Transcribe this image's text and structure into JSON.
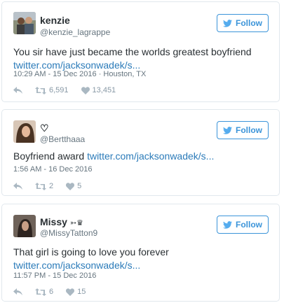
{
  "colors": {
    "accent": "#3b94d9",
    "link": "#2b7bb9",
    "muted": "#66757f",
    "icon": "#aab8c2"
  },
  "tweets": [
    {
      "name": "kenzie",
      "handle": "@kenzie_lagrappe",
      "follow_label": "Follow",
      "text": "You sir have just became the worlds greatest boyfriend",
      "link": "twitter.com/jacksonwadek/s...",
      "meta": "10:29 AM - 15 Dec 2016 · Houston, TX",
      "retweets": "6,591",
      "likes": "13,451"
    },
    {
      "name": "♡",
      "handle": "@Bertthaaa",
      "follow_label": "Follow",
      "text": "Boyfriend award",
      "link": "twitter.com/jacksonwadek/s...",
      "meta": "1:56 AM - 16 Dec 2016",
      "retweets": "2",
      "likes": "5"
    },
    {
      "name": "Missy",
      "name_emoji": "➳♛",
      "handle": "@MissyTatton9",
      "follow_label": "Follow",
      "text": "That girl is going to love you forever",
      "link": "twitter.com/jacksonwadek/s...",
      "meta": "11:57 PM - 15 Dec 2016",
      "retweets": "6",
      "likes": "15"
    }
  ]
}
